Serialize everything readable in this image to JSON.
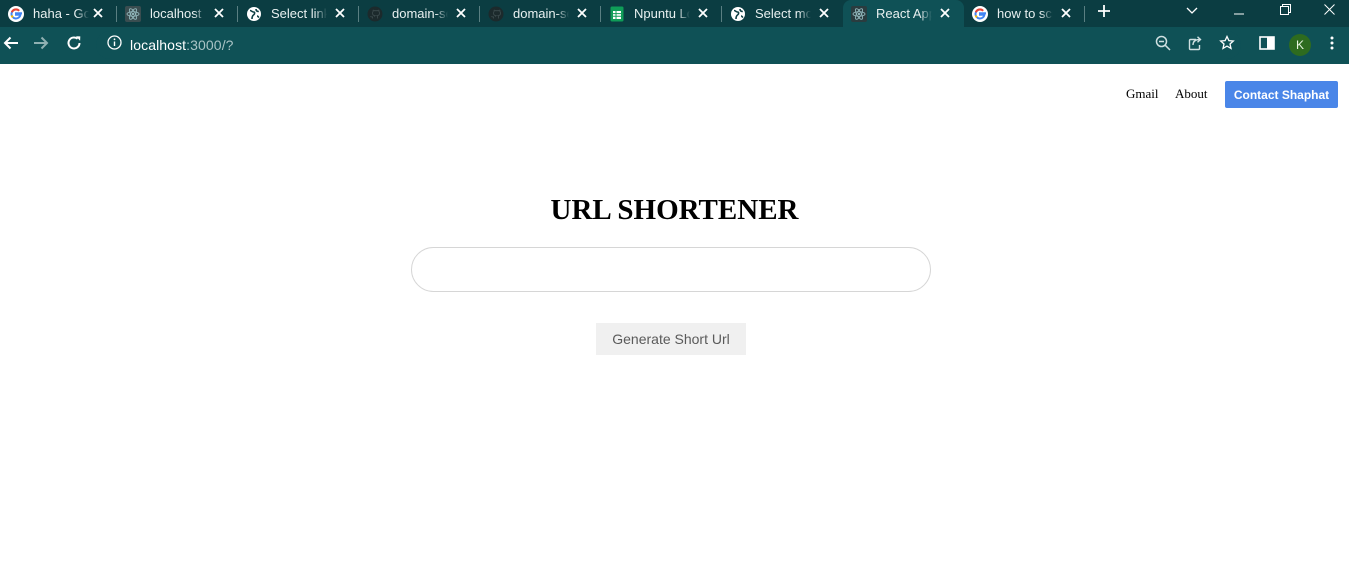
{
  "browser": {
    "tabs": [
      {
        "title": "haha - Google Search",
        "favicon": "google-icon",
        "active": false
      },
      {
        "title": "localhost",
        "favicon": "react-icon",
        "active": false
      },
      {
        "title": "Select link",
        "favicon": "globe-icon",
        "active": false
      },
      {
        "title": "domain-se",
        "favicon": "github-icon",
        "active": false
      },
      {
        "title": "domain-se",
        "favicon": "github-icon",
        "active": false
      },
      {
        "title": "Npuntu Lo",
        "favicon": "sheets-icon",
        "active": false
      },
      {
        "title": "Select mob",
        "favicon": "globe-icon",
        "active": false
      },
      {
        "title": "React App",
        "favicon": "react-icon",
        "active": true
      },
      {
        "title": "how to scr",
        "favicon": "google-icon",
        "active": false
      }
    ],
    "address": {
      "host": "localhost",
      "path": ":3000/?"
    },
    "profile_initial": "K"
  },
  "page": {
    "nav": {
      "gmail": "Gmail",
      "about": "About",
      "contact": "Contact Shaphat"
    },
    "heading": "URL SHORTENER",
    "url_input": {
      "value": "",
      "placeholder": ""
    },
    "generate_button": "Generate Short Url"
  },
  "colors": {
    "tabstrip_bg": "#0b3d42",
    "toolbar_bg": "#0f5156",
    "contact_button_bg": "#4a86e8",
    "generate_button_bg": "#f0f0f0"
  }
}
